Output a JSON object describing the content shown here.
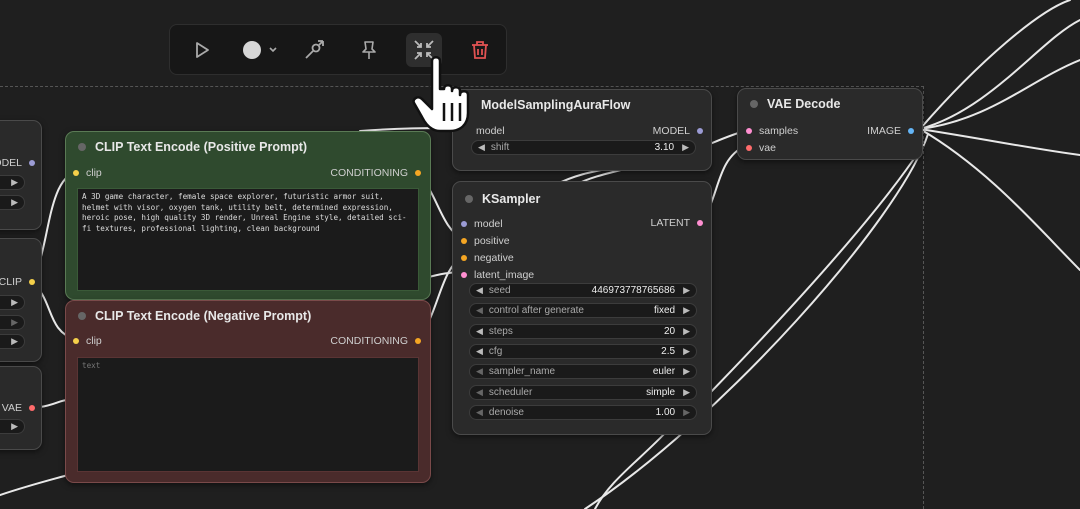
{
  "toolbar": {
    "buttons": [
      {
        "name": "run-icon"
      },
      {
        "name": "color-circle-icon"
      },
      {
        "name": "bypass-icon"
      },
      {
        "name": "pin-icon"
      },
      {
        "name": "collapse-icon"
      },
      {
        "name": "delete-icon"
      }
    ],
    "accent_delete": "#e05252"
  },
  "partial_left_nodes": {
    "model_label": "ODEL",
    "clip_label": "CLIP",
    "vae_label": "VAE"
  },
  "positive_prompt": {
    "title": "CLIP Text Encode (Positive Prompt)",
    "input_clip": "clip",
    "output": "CONDITIONING",
    "text": "A 3D game character, female space explorer, futuristic armor suit, helmet with visor, oxygen tank, utility belt, determined expression, heroic pose, high quality 3D render, Unreal Engine style, detailed sci-fi textures, professional lighting, clean background",
    "color": "#2f4a2e"
  },
  "negative_prompt": {
    "title": "CLIP Text Encode (Negative Prompt)",
    "input_clip": "clip",
    "output": "CONDITIONING",
    "placeholder": "text",
    "color": "#4a2b2b"
  },
  "model_sampling": {
    "title": "ModelSamplingAuraFlow",
    "input_model": "model",
    "output": "MODEL",
    "shift_label": "shift",
    "shift_value": "3.10"
  },
  "ksampler": {
    "title": "KSampler",
    "inputs": [
      "model",
      "positive",
      "negative",
      "latent_image"
    ],
    "output": "LATENT",
    "widgets": [
      {
        "label": "seed",
        "value": "446973778765686"
      },
      {
        "label": "control after generate",
        "value": "fixed"
      },
      {
        "label": "steps",
        "value": "20"
      },
      {
        "label": "cfg",
        "value": "2.5"
      },
      {
        "label": "sampler_name",
        "value": "euler"
      },
      {
        "label": "scheduler",
        "value": "simple"
      },
      {
        "label": "denoise",
        "value": "1.00"
      }
    ]
  },
  "vae_decode": {
    "title": "VAE Decode",
    "inputs": [
      "samples",
      "vae"
    ],
    "output": "IMAGE"
  },
  "pin_colors": {
    "model": "#9b9bd4",
    "clip": "#f5d04a",
    "conditioning": "#f5a623",
    "latent": "#ff8fd1",
    "vae": "#ff6b6b",
    "image": "#64b5f6"
  }
}
